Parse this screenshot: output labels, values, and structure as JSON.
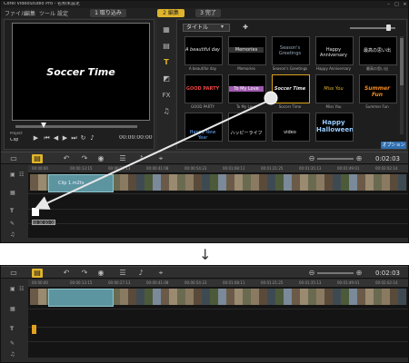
{
  "app": {
    "title": "Corel VideoStudio Pro - 名称未設定",
    "menu": [
      "ファイル",
      "編集",
      "ツール",
      "設定"
    ],
    "steps": [
      "1 取り込み",
      "2 編集",
      "3 完了"
    ],
    "active_step": "2 編集"
  },
  "preview": {
    "title_text": "Soccer Time",
    "mode_label": "Project",
    "clip_label": "Clip",
    "timecode": "00:00:00:00"
  },
  "library": {
    "category": "タイトル",
    "options_label": "オプション",
    "items": [
      {
        "text": "A beautiful day",
        "label": "A beautiful day"
      },
      {
        "text": "Memories",
        "label": "Memories"
      },
      {
        "text": "Season's Greetings",
        "label": "Season's Greetings"
      },
      {
        "text": "Happy Anniversary",
        "label": "Happy Anniversary"
      },
      {
        "text": "最高の思い出",
        "label": "最高の思い出"
      },
      {
        "text": "GOOD PARTY",
        "label": "GOOD PARTY"
      },
      {
        "text": "To My Love",
        "label": "To My Love"
      },
      {
        "text": "Soccer Time",
        "label": "Soccer Time"
      },
      {
        "text": "Miss You",
        "label": "Miss You"
      },
      {
        "text": "Summer Fun",
        "label": "Summer Fun"
      },
      {
        "text": "Happy New Year",
        "label": ""
      },
      {
        "text": "ハッピーライフ",
        "label": ""
      },
      {
        "text": "video",
        "label": ""
      },
      {
        "text": "Happy Halloween",
        "label": ""
      }
    ],
    "selected": "Soccer Time"
  },
  "timeline": {
    "timecode": "0:02:03",
    "ruler": [
      "00:00:00",
      "00:00:13:15",
      "00:00:27:13",
      "00:00:41:08",
      "00:00:54:23",
      "00:01:08:11",
      "00:01:21:25",
      "00:01:35:13",
      "00:01:49:01",
      "00:02:02:14"
    ],
    "clip_label": "Clip 1.m2ts",
    "drop_tag": "00:00:00:00"
  },
  "bottom_timeline": {
    "timecode": "0:02:03",
    "ruler": [
      "00:00:00",
      "00:00:13:15",
      "00:00:27:13",
      "00:00:41:08",
      "00:00:54:23",
      "00:01:08:11",
      "00:01:21:25",
      "00:01:35:13",
      "00:01:49:01",
      "00:02:02:14"
    ]
  },
  "colors": {
    "accent": "#e0b42b",
    "clip": "#5c95a0",
    "title_clip": "#e0a020",
    "drag_arrow": "#e8e8e8"
  }
}
